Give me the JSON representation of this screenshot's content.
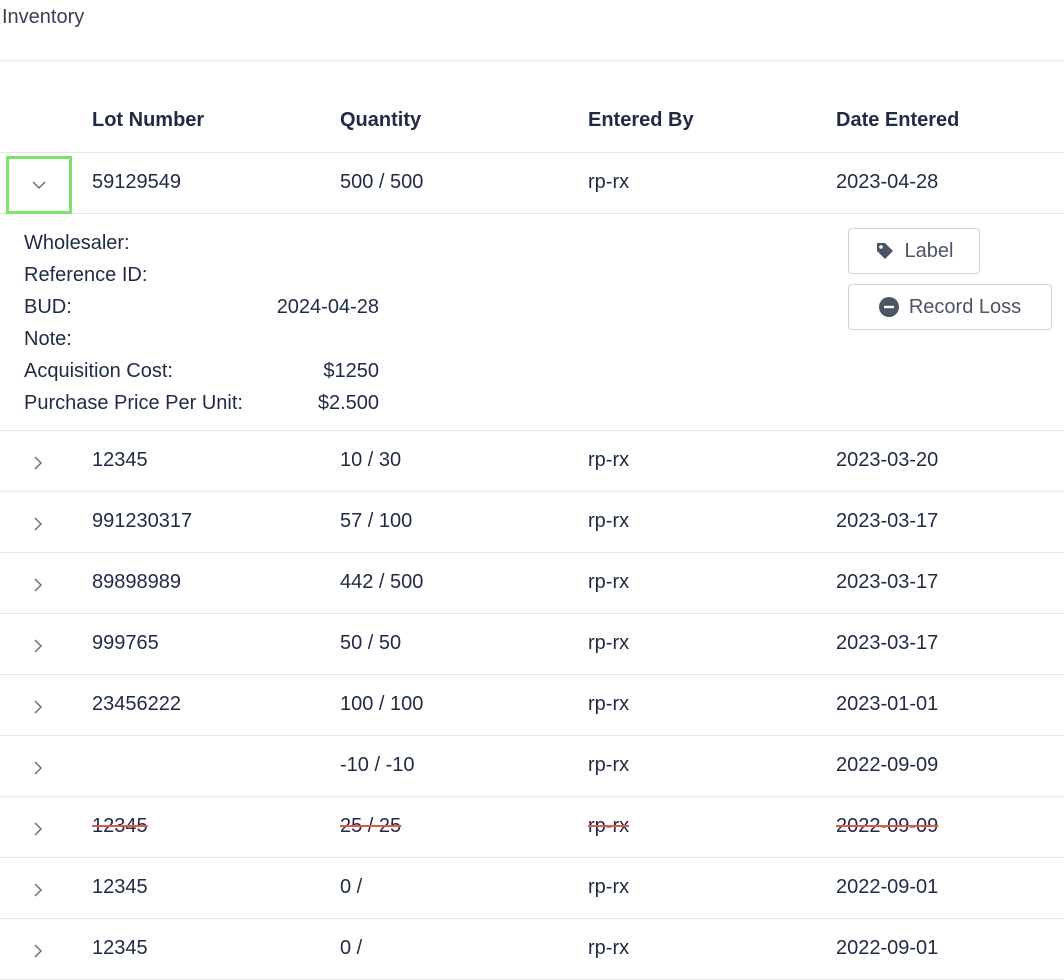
{
  "page": {
    "title": "Inventory"
  },
  "table": {
    "columns": [
      "Lot Number",
      "Quantity",
      "Entered By",
      "Date Entered"
    ],
    "expanded": {
      "lot": "59129549",
      "quantity": "500 / 500",
      "entered_by": "rp-rx",
      "date": "2023-04-28",
      "details": [
        {
          "label": "Wholesaler:",
          "value": ""
        },
        {
          "label": "Reference ID:",
          "value": ""
        },
        {
          "label": "BUD:",
          "value": "2024-04-28"
        },
        {
          "label": "Note:",
          "value": ""
        },
        {
          "label": "Acquisition Cost:",
          "value": "$1250"
        },
        {
          "label": "Purchase Price Per Unit:",
          "value": "$2.500"
        }
      ],
      "buttons": {
        "label": "Label",
        "record_loss": "Record Loss"
      }
    },
    "rows": [
      {
        "lot": "12345",
        "quantity": "10 / 30",
        "entered_by": "rp-rx",
        "date": "2023-03-20",
        "voided": false
      },
      {
        "lot": "991230317",
        "quantity": "57 / 100",
        "entered_by": "rp-rx",
        "date": "2023-03-17",
        "voided": false
      },
      {
        "lot": "89898989",
        "quantity": "442 / 500",
        "entered_by": "rp-rx",
        "date": "2023-03-17",
        "voided": false
      },
      {
        "lot": "999765",
        "quantity": "50 / 50",
        "entered_by": "rp-rx",
        "date": "2023-03-17",
        "voided": false
      },
      {
        "lot": "23456222",
        "quantity": "100 / 100",
        "entered_by": "rp-rx",
        "date": "2023-01-01",
        "voided": false
      },
      {
        "lot": "",
        "quantity": "-10 / -10",
        "entered_by": "rp-rx",
        "date": "2022-09-09",
        "voided": false
      },
      {
        "lot": "12345",
        "quantity": "25 / 25",
        "entered_by": "rp-rx",
        "date": "2022-09-09",
        "voided": true
      },
      {
        "lot": "12345",
        "quantity": "0 /",
        "entered_by": "rp-rx",
        "date": "2022-09-01",
        "voided": false
      },
      {
        "lot": "12345",
        "quantity": "0 /",
        "entered_by": "rp-rx",
        "date": "2022-09-01",
        "voided": false
      }
    ]
  },
  "icons": {
    "expand": "chevron-right-icon",
    "collapse": "chevron-down-icon",
    "tag": "tag-icon",
    "minus": "minus-circle-icon"
  },
  "colors": {
    "focus_outline": "#7ee36a",
    "strike": "#e05a4a"
  }
}
